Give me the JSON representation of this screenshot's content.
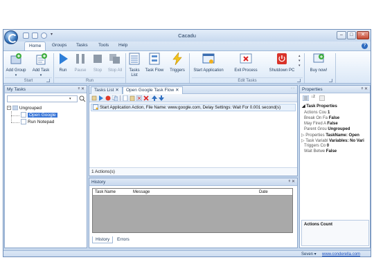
{
  "window": {
    "title": "Cacadu",
    "buttons": {
      "minimize": "–",
      "maximize": "□",
      "close": "✕"
    }
  },
  "ribbon_tabs": [
    "Home",
    "Groups",
    "Tasks",
    "Tools",
    "Help"
  ],
  "ribbon": {
    "buttons": {
      "add_group": "Add Group",
      "add_task": "Add Task",
      "run": "Run",
      "pause": "Pause",
      "stop": "Stop",
      "stop_all": "Stop All",
      "tasks_list": "Tasks List",
      "task_flow": "Task Flow",
      "triggers": "Triggers",
      "start_application": "Start Application",
      "exit_process": "Exit Process",
      "shutdown_pc": "Shutdown PC",
      "buy_now": "Buy now!"
    },
    "groups": {
      "start": "Start",
      "run": "Run",
      "edit_tasks": "Edit Tasks"
    }
  },
  "my_tasks": {
    "title": "My Tasks",
    "pin": "ᵠ ✕",
    "search_value": "",
    "tree": {
      "group": "Ungrouped",
      "items": [
        "Open Google",
        "Run Notepad"
      ]
    }
  },
  "doc_tabs": [
    "Tasks List",
    "Open Google Task Flow"
  ],
  "actions": {
    "items": [
      "Start Application Action, File Name: www.google.com, Delay Settings: Wait For 0.001 second(s)"
    ],
    "count": "1 Actions(s)"
  },
  "history": {
    "title": "History",
    "pin": "ᵠ ✕",
    "columns": [
      "Task Name",
      "Message",
      "Date"
    ],
    "tabs": [
      "History",
      "Errors"
    ]
  },
  "properties": {
    "title": "Properties",
    "pin": "ᵠ ✕",
    "section": "Task Properties",
    "rows": [
      {
        "name": "Actions Cou",
        "value": "1"
      },
      {
        "name": "Break On Fa",
        "value": "False"
      },
      {
        "name": "May Fired A",
        "value": "False"
      },
      {
        "name": "Parent Grou",
        "value": "Ungrouped"
      },
      {
        "name": "Properties",
        "value": "TaskName: Open"
      },
      {
        "name": "Task Variabl",
        "value": "Variables: No Vari"
      },
      {
        "name": "Triggers Co",
        "value": "0"
      },
      {
        "name": "Wait Betwe",
        "value": "False"
      }
    ],
    "actions_count_label": "Actions Count"
  },
  "status": {
    "theme": "Seven ▾",
    "link": "www.conderella.com"
  }
}
